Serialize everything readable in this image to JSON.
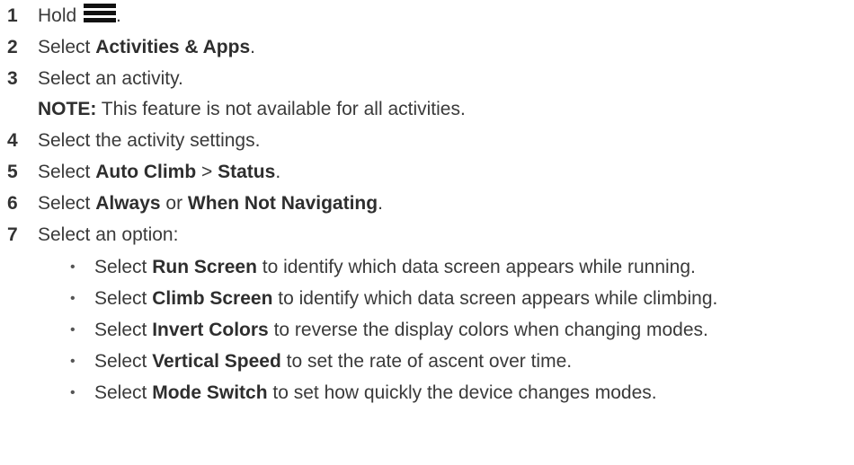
{
  "steps": [
    {
      "num": "1",
      "pre": "Hold ",
      "icon": "menu-icon",
      "post": "."
    },
    {
      "num": "2",
      "pre": "Select ",
      "bold": "Activities & Apps",
      "post": "."
    },
    {
      "num": "3",
      "text": "Select an activity."
    },
    {
      "note_label": "NOTE:",
      "note_text": " This feature is not available for all activities."
    },
    {
      "num": "4",
      "text": "Select the activity settings."
    },
    {
      "num": "5",
      "pre": "Select ",
      "bold1": "Auto Climb",
      "mid": " > ",
      "bold2": "Status",
      "post": "."
    },
    {
      "num": "6",
      "pre": "Select ",
      "bold1": "Always",
      "mid": " or ",
      "bold2": "When Not Navigating",
      "post": "."
    },
    {
      "num": "7",
      "text": "Select an option:"
    }
  ],
  "bullets": [
    {
      "dot": "•",
      "pre": "Select ",
      "bold": "Run Screen",
      "post": " to identify which data screen appears while running."
    },
    {
      "dot": "•",
      "pre": "Select ",
      "bold": "Climb Screen",
      "post": " to identify which data screen appears while climbing."
    },
    {
      "dot": "•",
      "pre": "Select ",
      "bold": "Invert Colors",
      "post": " to reverse the display colors when changing modes."
    },
    {
      "dot": "•",
      "pre": "Select ",
      "bold": "Vertical Speed",
      "post": " to set the rate of ascent over time."
    },
    {
      "dot": "•",
      "pre": "Select ",
      "bold": "Mode Switch",
      "post": " to set how quickly the device changes modes."
    }
  ]
}
